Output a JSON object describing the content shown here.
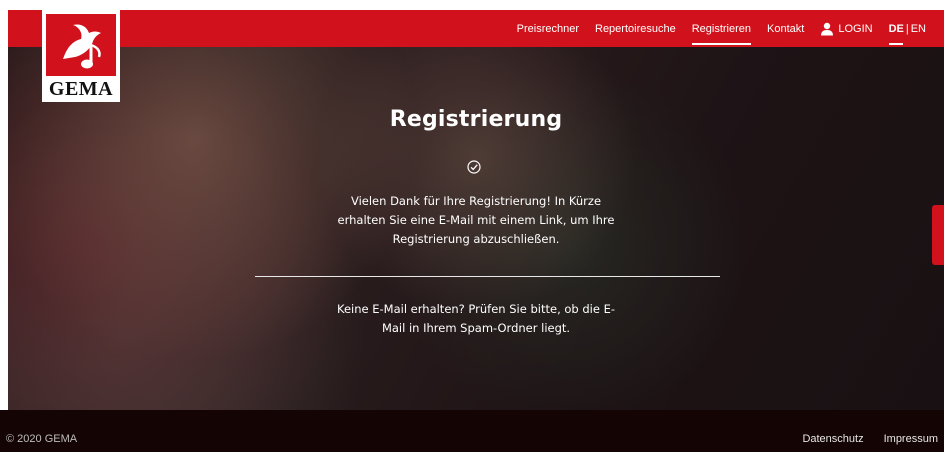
{
  "brand": {
    "logo_text": "GEMA"
  },
  "nav": {
    "items": [
      {
        "label": "Preisrechner"
      },
      {
        "label": "Repertoiresuche"
      },
      {
        "label": "Registrieren"
      },
      {
        "label": "Kontakt"
      }
    ],
    "login_label": "LOGIN",
    "lang_de": "DE",
    "lang_sep": "|",
    "lang_en": "EN"
  },
  "main": {
    "title": "Registrierung",
    "confirmation": "Vielen Dank für Ihre Registrierung! In Kürze erhalten Sie eine E-Mail mit einem Link, um Ihre Registrierung abzuschließen.",
    "hint": "Keine E-Mail erhalten? Prüfen Sie bitte, ob die E-Mail in Ihrem Spam-Ordner liegt."
  },
  "footer": {
    "copyright": "© 2020 GEMA",
    "links": [
      {
        "label": "Datenschutz"
      },
      {
        "label": "Impressum"
      }
    ]
  },
  "colors": {
    "brand_red": "#d1111b",
    "footer_bg": "#150404"
  },
  "icons": {
    "check": "check-circle-icon",
    "user": "user-icon"
  }
}
